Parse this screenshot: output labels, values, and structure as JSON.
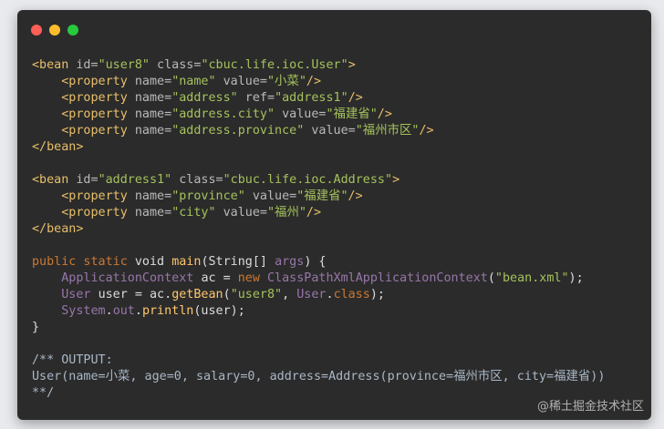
{
  "window": {
    "controls": [
      "close",
      "minimize",
      "maximize"
    ]
  },
  "code_lines": [
    [
      [
        "t-tag",
        "<bean "
      ],
      [
        "t-attr",
        "id="
      ],
      [
        "t-str",
        "\"user8\""
      ],
      [
        "t-attr",
        " class="
      ],
      [
        "t-str",
        "\"cbuc.life.ioc.User\""
      ],
      [
        "t-tag",
        ">"
      ]
    ],
    [
      [
        "t-tag",
        "    <property "
      ],
      [
        "t-attr",
        "name="
      ],
      [
        "t-str",
        "\"name\""
      ],
      [
        "t-attr",
        " value="
      ],
      [
        "t-str",
        "\"小菜\""
      ],
      [
        "t-tag",
        "/>"
      ]
    ],
    [
      [
        "t-tag",
        "    <property "
      ],
      [
        "t-attr",
        "name="
      ],
      [
        "t-str",
        "\"address\""
      ],
      [
        "t-attr",
        " ref="
      ],
      [
        "t-str",
        "\"address1\""
      ],
      [
        "t-tag",
        "/>"
      ]
    ],
    [
      [
        "t-tag",
        "    <property "
      ],
      [
        "t-attr",
        "name="
      ],
      [
        "t-str",
        "\"address.city\""
      ],
      [
        "t-attr",
        " value="
      ],
      [
        "t-str",
        "\"福建省\""
      ],
      [
        "t-tag",
        "/>"
      ]
    ],
    [
      [
        "t-tag",
        "    <property "
      ],
      [
        "t-attr",
        "name="
      ],
      [
        "t-str",
        "\"address.province\""
      ],
      [
        "t-attr",
        " value="
      ],
      [
        "t-str",
        "\"福州市区\""
      ],
      [
        "t-tag",
        "/>"
      ]
    ],
    [
      [
        "t-tag",
        "</bean>"
      ]
    ],
    [],
    [
      [
        "t-tag",
        "<bean "
      ],
      [
        "t-attr",
        "id="
      ],
      [
        "t-str",
        "\"address1\""
      ],
      [
        "t-attr",
        " class="
      ],
      [
        "t-str",
        "\"cbuc.life.ioc.Address\""
      ],
      [
        "t-tag",
        ">"
      ]
    ],
    [
      [
        "t-tag",
        "    <property "
      ],
      [
        "t-attr",
        "name="
      ],
      [
        "t-str",
        "\"province\""
      ],
      [
        "t-attr",
        " value="
      ],
      [
        "t-str",
        "\"福建省\""
      ],
      [
        "t-tag",
        "/>"
      ]
    ],
    [
      [
        "t-tag",
        "    <property "
      ],
      [
        "t-attr",
        "name="
      ],
      [
        "t-str",
        "\"city\""
      ],
      [
        "t-attr",
        " value="
      ],
      [
        "t-str",
        "\"福州\""
      ],
      [
        "t-tag",
        "/>"
      ]
    ],
    [
      [
        "t-tag",
        "</bean>"
      ]
    ],
    [],
    [
      [
        "t-kw",
        "public static "
      ],
      [
        "t-plain",
        "void "
      ],
      [
        "t-fn",
        "main"
      ],
      [
        "t-plain",
        "(String[] "
      ],
      [
        "t-cls",
        "args"
      ],
      [
        "t-plain",
        ") {"
      ]
    ],
    [
      [
        "t-plain",
        "    "
      ],
      [
        "t-cls",
        "ApplicationContext "
      ],
      [
        "t-plain",
        "ac = "
      ],
      [
        "t-kw",
        "new "
      ],
      [
        "t-cls",
        "ClassPathXmlApplicationContext"
      ],
      [
        "t-plain",
        "("
      ],
      [
        "t-str",
        "\"bean.xml\""
      ],
      [
        "t-plain",
        ");"
      ]
    ],
    [
      [
        "t-plain",
        "    "
      ],
      [
        "t-cls",
        "User "
      ],
      [
        "t-plain",
        "user = ac."
      ],
      [
        "t-fn",
        "getBean"
      ],
      [
        "t-plain",
        "("
      ],
      [
        "t-str",
        "\"user8\""
      ],
      [
        "t-plain",
        ", "
      ],
      [
        "t-cls",
        "User"
      ],
      [
        "t-plain",
        "."
      ],
      [
        "t-kw",
        "class"
      ],
      [
        "t-plain",
        ");"
      ]
    ],
    [
      [
        "t-plain",
        "    "
      ],
      [
        "t-cls",
        "System"
      ],
      [
        "t-plain",
        "."
      ],
      [
        "t-cls",
        "out"
      ],
      [
        "t-plain",
        "."
      ],
      [
        "t-fn",
        "println"
      ],
      [
        "t-plain",
        "(user);"
      ]
    ],
    [
      [
        "t-plain",
        "}"
      ]
    ],
    [],
    [
      [
        "t-comment",
        "/** OUTPUT:"
      ]
    ],
    [
      [
        "t-comment",
        "User(name=小菜, age=0, salary=0, address=Address(province=福州市区, city=福建省))"
      ]
    ],
    [
      [
        "t-comment",
        "**/"
      ]
    ]
  ],
  "watermark": "@稀土掘金技术社区"
}
